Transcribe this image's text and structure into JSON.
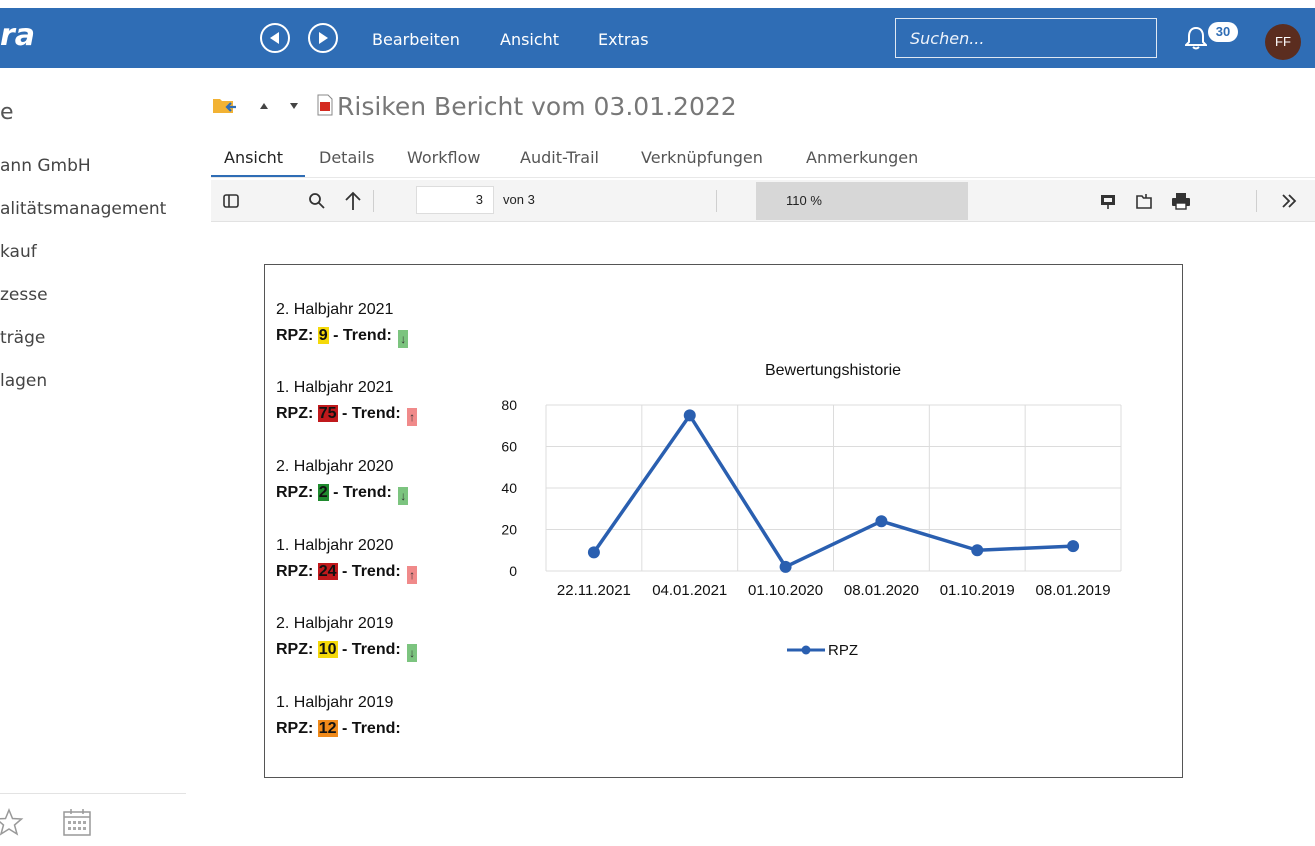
{
  "app": {
    "brand_partial": "ra",
    "menu": [
      "Bearbeiten",
      "Ansicht",
      "Extras"
    ],
    "search_placeholder": "Suchen...",
    "notification_count": "30",
    "avatar_initials": "FF"
  },
  "sidebar": {
    "title_partial": "e",
    "items": [
      "ann GmbH",
      "alitätsmanagement",
      "kauf",
      "zesse",
      "träge",
      "lagen"
    ]
  },
  "document": {
    "title": "Risiken Bericht vom 03.01.2022",
    "tabs": [
      "Ansicht",
      "Details",
      "Workflow",
      "Audit-Trail",
      "Verknüpfungen",
      "Anmerkungen"
    ],
    "active_tab": "Ansicht"
  },
  "viewer": {
    "page_current": "3",
    "page_total_label": "von 3",
    "zoom": "110 %"
  },
  "report": {
    "rpz_prefix": "RPZ:",
    "trend_label": "- Trend:",
    "entries": [
      {
        "period": "2. Halbjahr 2021",
        "rpz": "9",
        "rpz_color": "#f5d90a",
        "trend": "down",
        "trend_color": "#7cc47f"
      },
      {
        "period": "1. Halbjahr 2021",
        "rpz": "75",
        "rpz_color": "#c0191c",
        "trend": "up",
        "trend_color": "#f08a8a"
      },
      {
        "period": "2. Halbjahr 2020",
        "rpz": "2",
        "rpz_color": "#1f8a2e",
        "trend": "down",
        "trend_color": "#7cc47f"
      },
      {
        "period": "1. Halbjahr 2020",
        "rpz": "24",
        "rpz_color": "#c0191c",
        "trend": "up",
        "trend_color": "#f08a8a"
      },
      {
        "period": "2. Halbjahr 2019",
        "rpz": "10",
        "rpz_color": "#f5d90a",
        "trend": "down",
        "trend_color": "#7cc47f"
      },
      {
        "period": "1. Halbjahr 2019",
        "rpz": "12",
        "rpz_color": "#f08a1a",
        "trend": "",
        "trend_color": ""
      }
    ]
  },
  "chart_data": {
    "type": "line",
    "title": "Bewertungshistorie",
    "categories": [
      "22.11.2021",
      "04.01.2021",
      "01.10.2020",
      "08.01.2020",
      "01.10.2019",
      "08.01.2019"
    ],
    "series": [
      {
        "name": "RPZ",
        "values": [
          9,
          75,
          2,
          24,
          10,
          12
        ],
        "color": "#2a5fb0"
      }
    ],
    "ylim": [
      0,
      80
    ],
    "yticks": [
      0,
      20,
      40,
      60,
      80
    ],
    "grid": true,
    "legend": "bottom"
  }
}
